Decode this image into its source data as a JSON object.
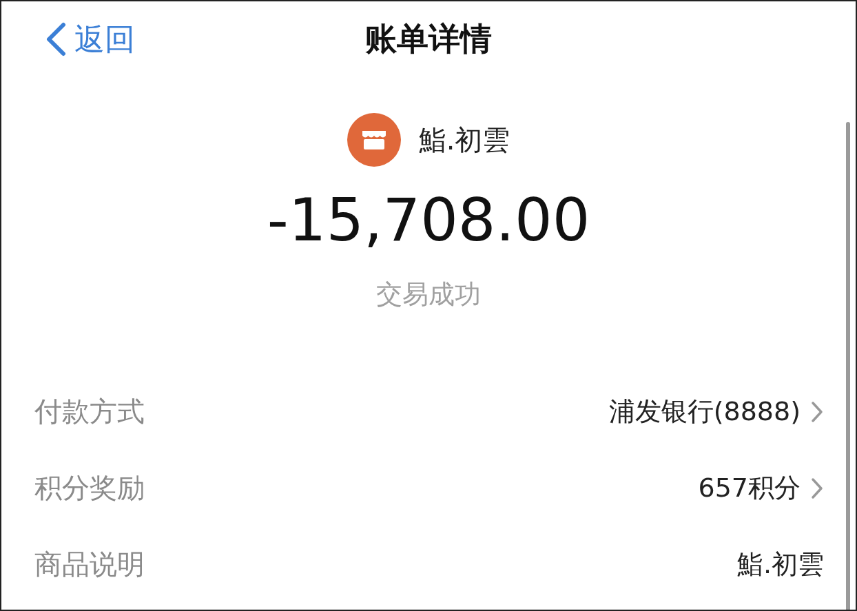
{
  "nav": {
    "back_label": "返回",
    "title": "账单详情"
  },
  "merchant": {
    "name": "鮨.初雲"
  },
  "amount": "-15,708.00",
  "status": "交易成功",
  "details": [
    {
      "label": "付款方式",
      "value": "浦发银行(8888)",
      "kind": "link"
    },
    {
      "label": "积分奖励",
      "value": "657积分",
      "kind": "link"
    },
    {
      "label": "商品说明",
      "value": "鮨.初雲",
      "kind": "plain"
    }
  ]
}
